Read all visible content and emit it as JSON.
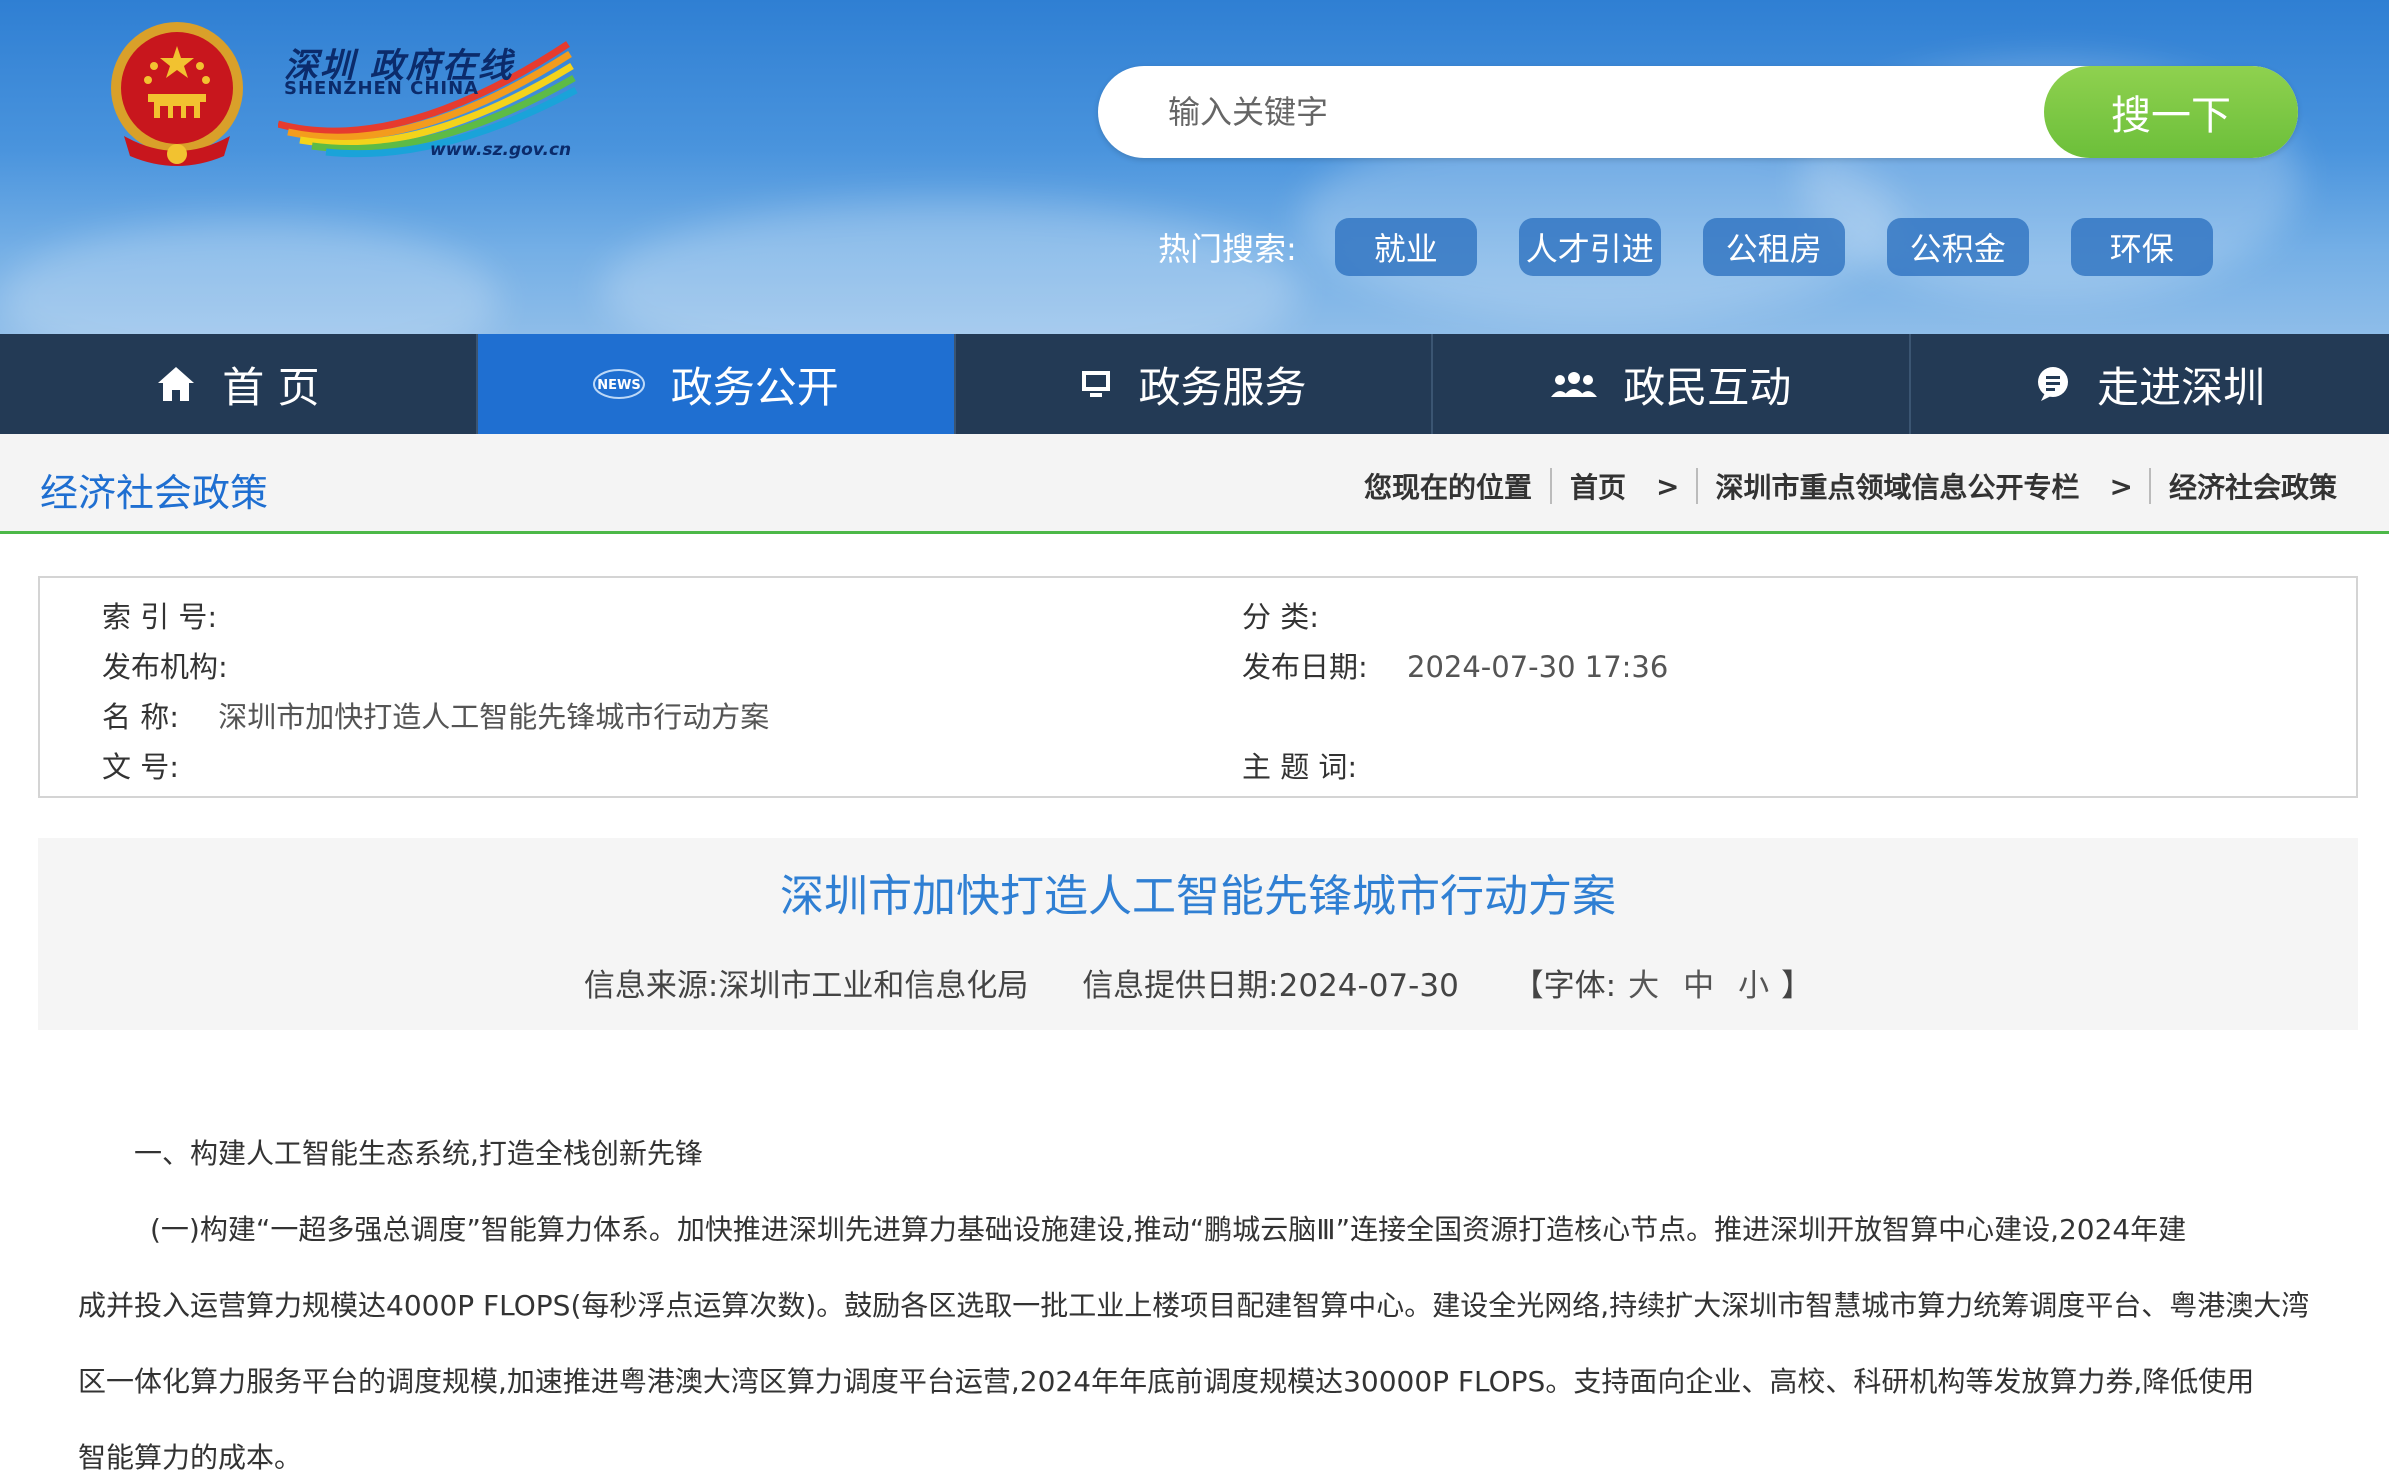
{
  "header": {
    "logo": {
      "cn": "深圳 政府在线",
      "en": "SHENZHEN CHINA",
      "url": "www.sz.gov.cn"
    },
    "search": {
      "placeholder": "输入关键字",
      "button_label": "搜一下"
    },
    "hot_search": {
      "label": "热门搜索:",
      "tags": [
        "就业",
        "人才引进",
        "公租房",
        "公积金",
        "环保"
      ]
    }
  },
  "nav": {
    "items": [
      {
        "label": "首 页",
        "icon": "home-icon"
      },
      {
        "label": "政务公开",
        "icon": "news-icon"
      },
      {
        "label": "政务服务",
        "icon": "monitor-icon"
      },
      {
        "label": "政民互动",
        "icon": "people-icon"
      },
      {
        "label": "走进深圳",
        "icon": "chat-icon"
      }
    ],
    "active_index": 1
  },
  "crumb_bar": {
    "section_title": "经济社会政策",
    "location_label": "您现在的位置",
    "items": [
      "首页",
      "深圳市重点领域信息公开专栏",
      "经济社会政策"
    ],
    "separator": ">"
  },
  "meta": {
    "index_no": {
      "label": "索 引 号:",
      "value": ""
    },
    "category": {
      "label": "分 类:",
      "value": ""
    },
    "publisher": {
      "label": "发布机构:",
      "value": ""
    },
    "publish_date": {
      "label": "发布日期:",
      "value": "2024-07-30 17:36"
    },
    "name": {
      "label": "名 称:",
      "value": "深圳市加快打造人工智能先锋城市行动方案"
    },
    "doc_no": {
      "label": "文 号:",
      "value": ""
    },
    "keywords": {
      "label": "主 题 词:",
      "value": ""
    }
  },
  "article": {
    "title": "深圳市加快打造人工智能先锋城市行动方案",
    "source": "信息来源:深圳市工业和信息化局",
    "date": "信息提供日期:2024-07-30",
    "font_label_open": "【字体:",
    "font_sizes": [
      "大",
      "中",
      "小"
    ],
    "font_label_close": "】",
    "heading": "一、构建人工智能生态系统,打造全栈创新先锋",
    "paragraph_lines": [
      "(一)构建“一超多强总调度”智能算力体系。加快推进深圳先进算力基础设施建设,推动“鹏城云脑Ⅲ”连接全国资源打造核心节点。推进深圳开放智算中心建设,2024年建",
      "成并投入运营算力规模达4000P FLOPS(每秒浮点运算次数)。鼓励各区选取一批工业上楼项目配建智算中心。建设全光网络,持续扩大深圳市智慧城市算力统筹调度平台、粤港澳大湾",
      "区一体化算力服务平台的调度规模,加速推进粤港澳大湾区算力调度平台运营,2024年年底前调度规模达30000P FLOPS。支持面向企业、高校、科研机构等发放算力券,降低使用",
      "智能算力的成本。"
    ]
  }
}
